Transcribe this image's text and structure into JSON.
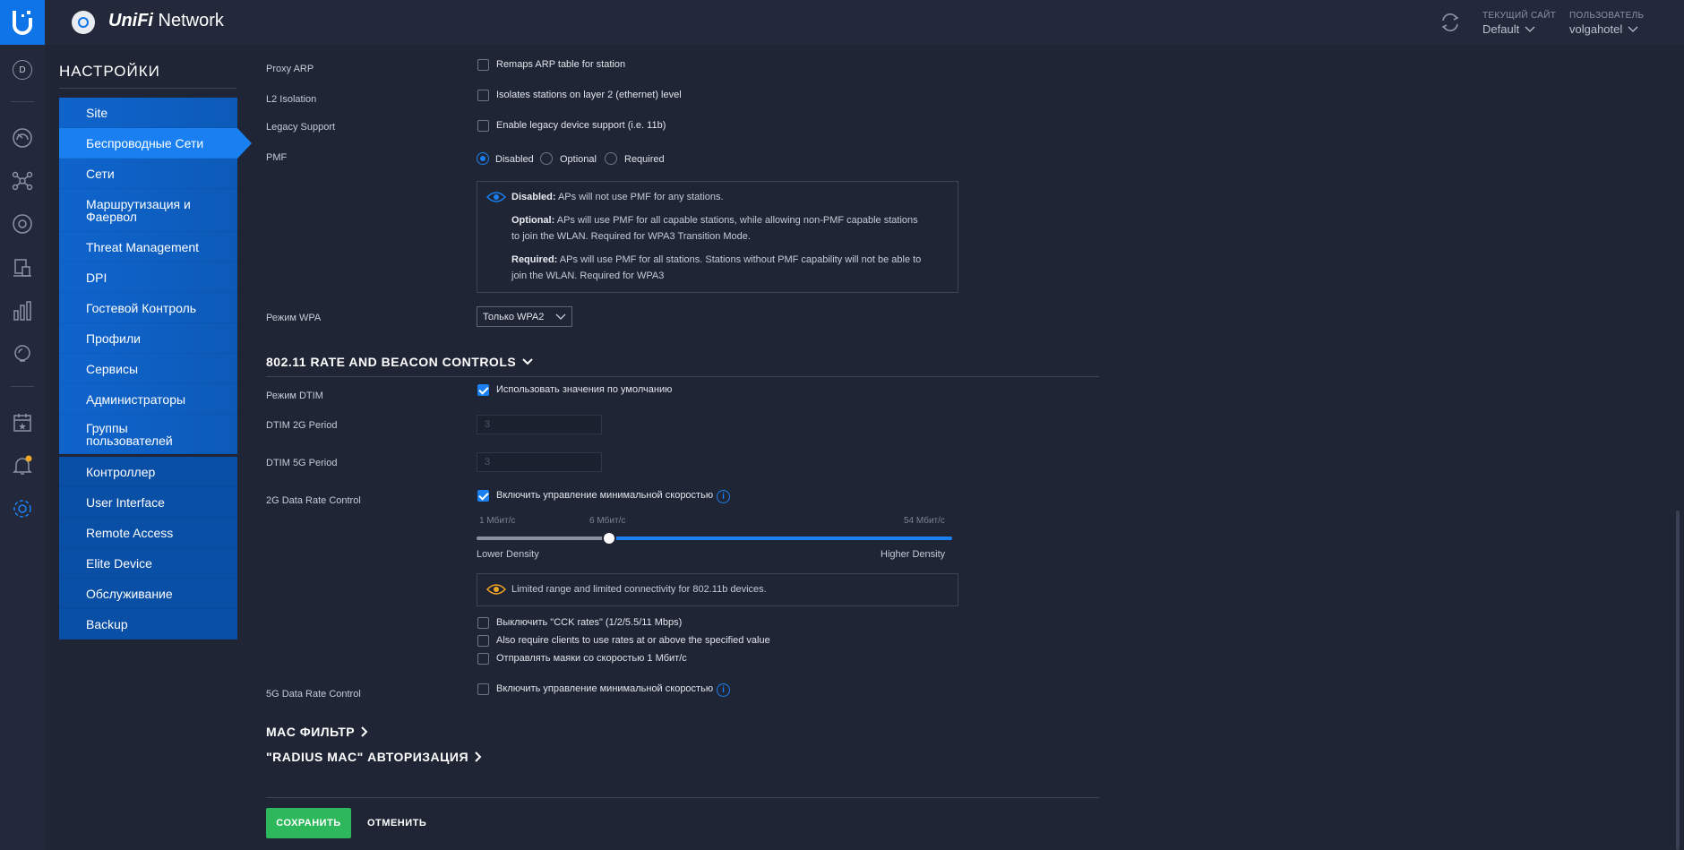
{
  "header": {
    "app_name_brand": "UniFi",
    "app_name_rest": " Network",
    "site_caption": "ТЕКУЩИЙ САЙТ",
    "site_value": "Default",
    "user_caption": "ПОЛЬЗОВАТЕЛЬ",
    "user_value": "volgahotel"
  },
  "rail": {
    "avatar_letter": "D"
  },
  "nav": {
    "heading": "НАСТРОЙКИ",
    "items": [
      {
        "label": "Site"
      },
      {
        "label": "Беспроводные Сети"
      },
      {
        "label": "Сети"
      },
      {
        "label": "Маршрутизация и Фаервол"
      },
      {
        "label": "Threat Management"
      },
      {
        "label": "DPI"
      },
      {
        "label": "Гостевой Контроль"
      },
      {
        "label": "Профили"
      },
      {
        "label": "Сервисы"
      },
      {
        "label": "Администраторы"
      },
      {
        "label": "Группы пользователей"
      }
    ],
    "items2": [
      {
        "label": "Контроллер"
      },
      {
        "label": "User Interface"
      },
      {
        "label": "Remote Access"
      },
      {
        "label": "Elite Device"
      },
      {
        "label": "Обслуживание"
      },
      {
        "label": "Backup"
      }
    ]
  },
  "form": {
    "proxy_arp": {
      "label": "Proxy ARP",
      "checkbox": "Remaps ARP table for station"
    },
    "l2_isolation": {
      "label": "L2 Isolation",
      "checkbox": "Isolates stations on layer 2 (ethernet) level"
    },
    "legacy_support": {
      "label": "Legacy Support",
      "checkbox": "Enable legacy device support (i.e. 11b)"
    },
    "pmf": {
      "label": "PMF",
      "options": [
        "Disabled",
        "Optional",
        "Required"
      ],
      "selected": "Disabled",
      "info": {
        "disabled_title": "Disabled:",
        "disabled_text": " APs will not use PMF for any stations.",
        "optional_title": "Optional:",
        "optional_text_1": " APs will use PMF for all capable stations, while allowing non-PMF capable stations",
        "optional_text_2": "to join the WLAN. Required for WPA3 Transition Mode.",
        "required_title": "Required:",
        "required_text_1": " APs will use PMF for all stations. Stations without PMF capability will not be able to",
        "required_text_2": "join the WLAN. Required for WPA3"
      }
    },
    "wpa_mode": {
      "label": "Режим WPA",
      "value": "Только WPA2"
    },
    "rate_section_title": "802.11 RATE AND BEACON CONTROLS",
    "dtim_mode": {
      "label": "Режим DTIM",
      "checkbox": "Использовать значения по умолчанию",
      "checked": true
    },
    "dtim_2g": {
      "label": "DTIM 2G Period",
      "value": "3"
    },
    "dtim_5g": {
      "label": "DTIM 5G Period",
      "value": "3"
    },
    "rate_2g": {
      "label": "2G Data Rate Control",
      "checkbox": "Включить управление минимальной скоростью",
      "checked": true,
      "slider_min_label": "1 Мбит/с",
      "slider_current_label": "6 Мбит/с",
      "slider_max_label": "54 Мбит/с",
      "slider_value_mbps": 6,
      "left_caption": "Lower Density",
      "right_caption": "Higher Density",
      "warning": "Limited range and limited connectivity for 802.11b devices.",
      "opt_cck": "Выключить \"CCK rates\" (1/2/5.5/11 Mbps)",
      "opt_require": "Also require clients to use rates at or above the specified value",
      "opt_beacons": "Отправлять маяки со скоростью 1 Мбит/с"
    },
    "rate_5g": {
      "label": "5G Data Rate Control",
      "checkbox": "Включить управление минимальной скоростью"
    },
    "mac_filter_title": "MAC ФИЛЬТР",
    "radius_mac_title": "\"RADIUS MAC\" АВТОРИЗАЦИЯ",
    "save_label": "СОХРАНИТЬ",
    "cancel_label": "ОТМЕНИТЬ"
  },
  "colors": {
    "accent": "#1a80f1",
    "save_green": "#2eb85c",
    "warning_orange": "#f5a623",
    "background": "#1f2534"
  }
}
